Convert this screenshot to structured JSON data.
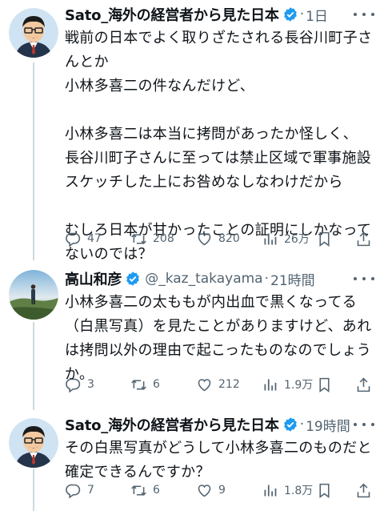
{
  "tweets": [
    {
      "display_name": "Sato_海外の経営者から見た日本",
      "handle": "",
      "time": "1日",
      "lines": [
        "戦前の日本でよく取りざたされる長谷川町子さ",
        "んとか",
        "小林多喜二の件なんだけど、",
        "",
        "小林多喜二は本当に拷問があったか怪しく、",
        "長谷川町子さんに至っては禁止区域で軍事施設",
        "スケッチした上にお咎めなしなわけだから",
        "",
        "むしろ日本が甘かったことの証明にしかなって",
        "ないのでは？"
      ],
      "replies": "47",
      "retweets": "208",
      "likes": "820",
      "views": "26万"
    },
    {
      "display_name": "高山和彦",
      "handle": "@_kaz_takayama",
      "time": "21時間",
      "lines": [
        "小林多喜二の太ももが内出血で黒くなってる",
        "（白黒写真）を見たことがありますけど、あれ",
        "は拷問以外の理由で起こったものなのでしょう",
        "か。"
      ],
      "replies": "3",
      "retweets": "6",
      "likes": "212",
      "views": "1.9万"
    },
    {
      "display_name": "Sato_海外の経営者から見た日本",
      "handle": "",
      "time": "19時間",
      "lines": [
        "その白黒写真がどうして小林多喜二のものだと",
        "確定できるんですか？"
      ],
      "replies": "7",
      "retweets": "6",
      "likes": "9",
      "views": "1.8万"
    }
  ],
  "colors": {
    "text": "#0f1419",
    "secondary": "#536471",
    "verified": "#1d9bf0",
    "thread_line": "#cfd9de"
  },
  "icons": [
    "reply-icon",
    "retweet-icon",
    "like-icon",
    "views-icon",
    "share-icon",
    "verified-badge-icon",
    "more-icon"
  ]
}
